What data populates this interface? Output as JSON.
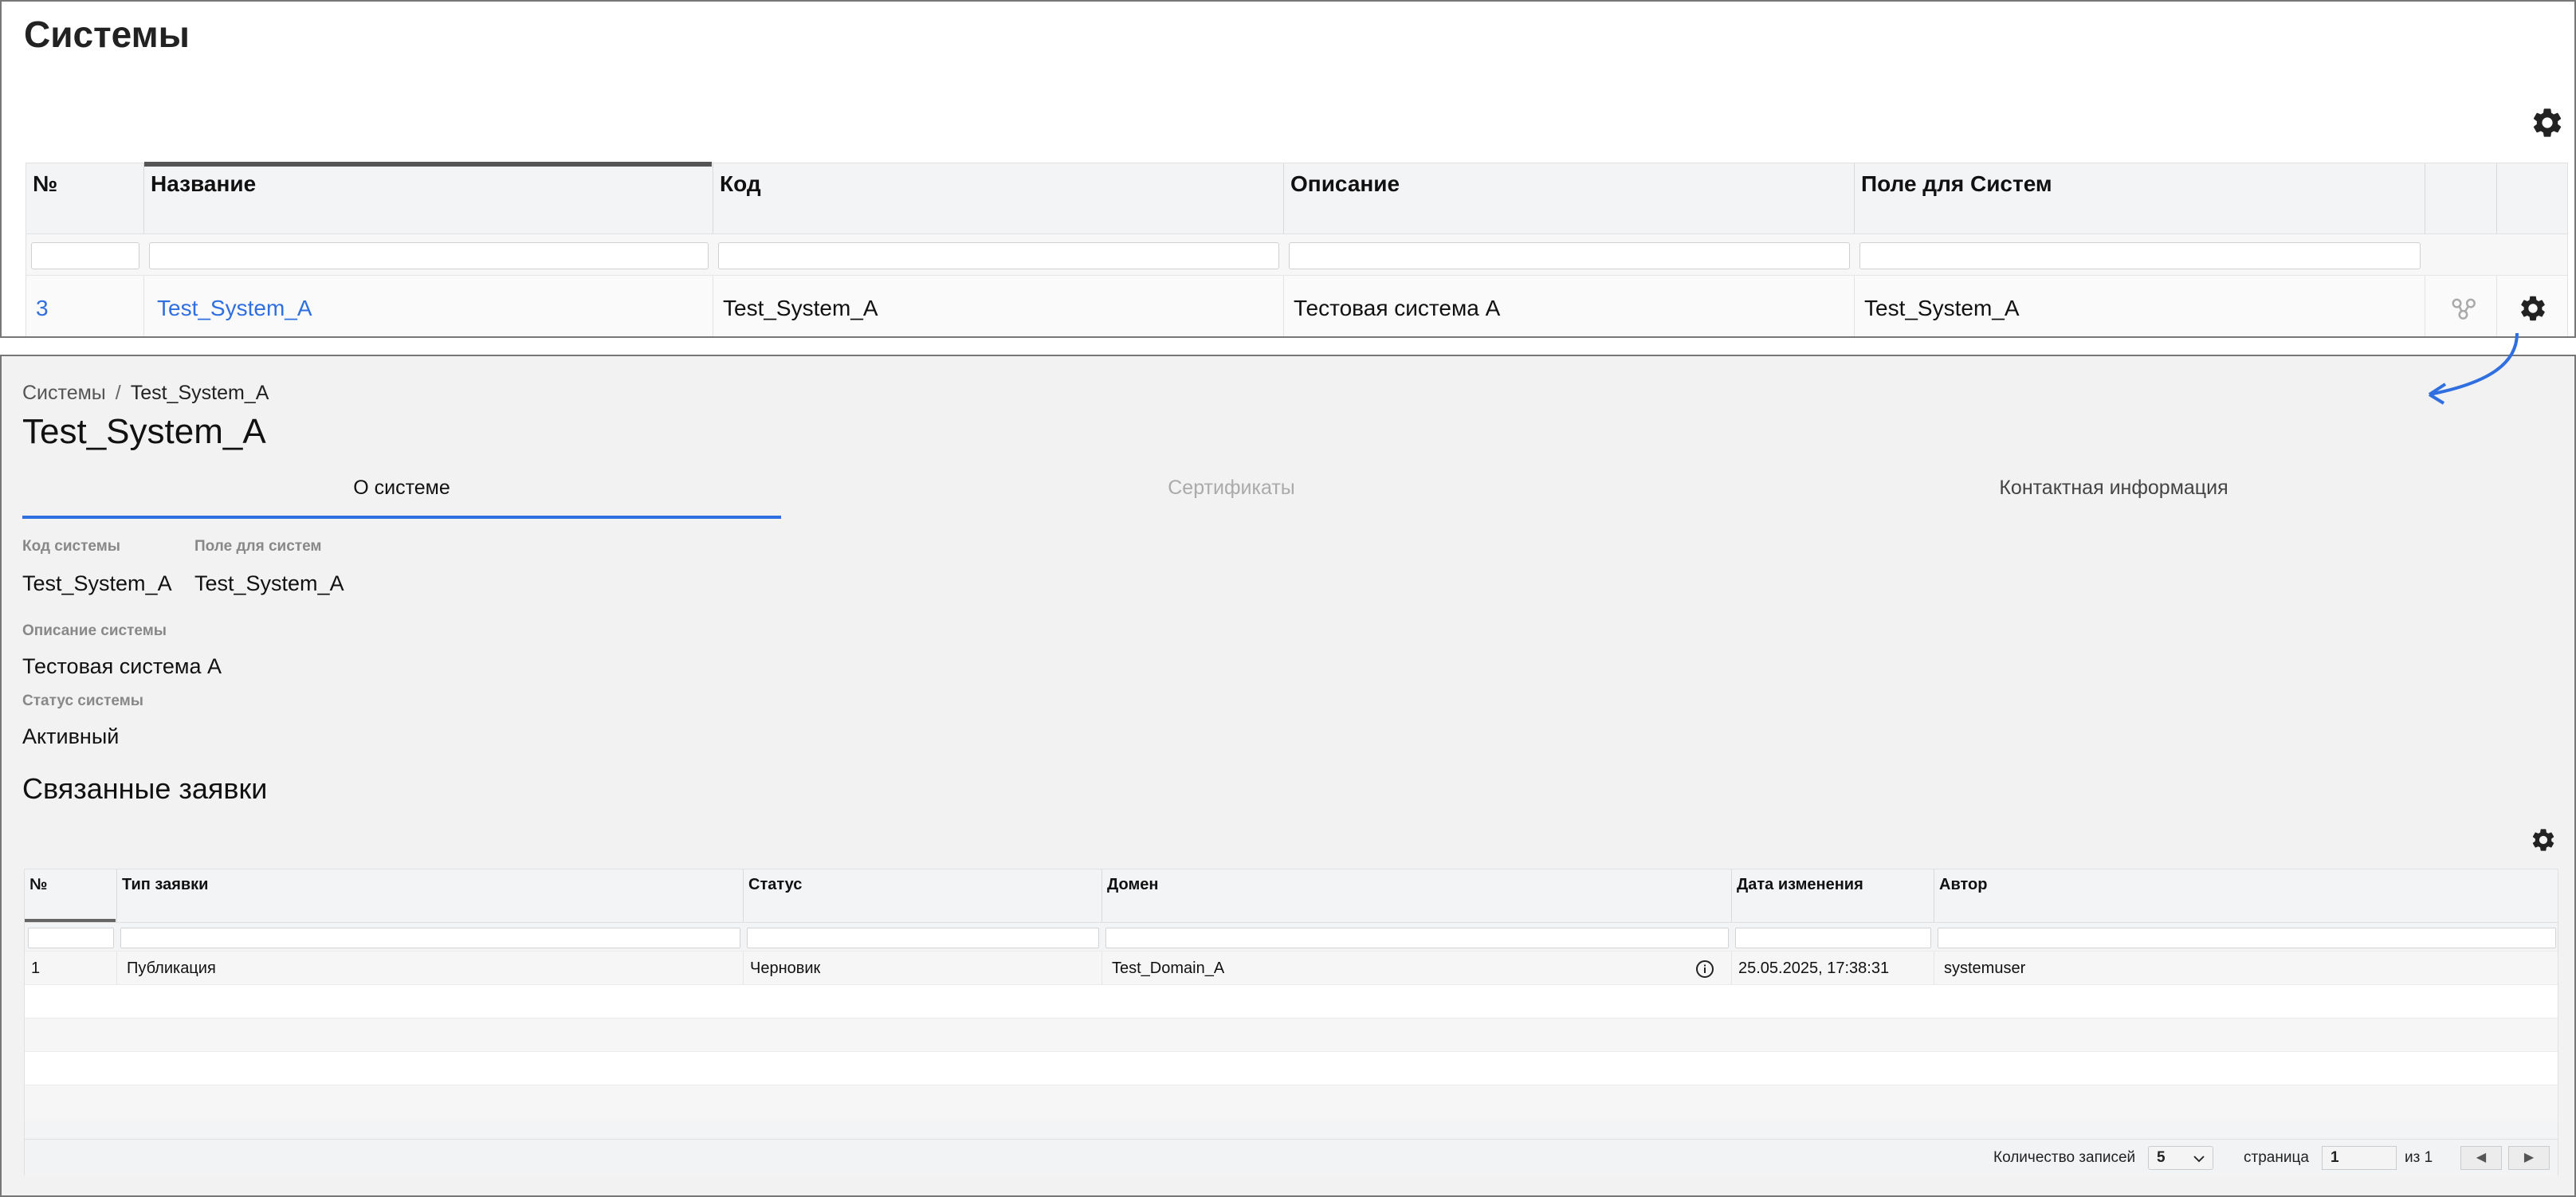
{
  "top": {
    "title": "Системы",
    "columns": [
      "№",
      "Название",
      "Код",
      "Описание",
      "Поле для Систем"
    ],
    "row": {
      "num": "3",
      "name": "Test_System_A",
      "code": "Test_System_A",
      "description": "Тестовая система А",
      "field": "Test_System_A"
    },
    "icons": {
      "settings": "gear-icon",
      "relations": "relations-icon"
    }
  },
  "detail": {
    "breadcrumb": {
      "root": "Системы",
      "separator": "/",
      "current": "Test_System_A"
    },
    "title": "Test_System_A",
    "tabs": [
      {
        "label": "О системе",
        "state": "active"
      },
      {
        "label": "Сертификаты",
        "state": "disabled"
      },
      {
        "label": "Контактная информация",
        "state": "normal"
      }
    ],
    "fields": {
      "code_label": "Код системы",
      "code_value": "Test_System_A",
      "field_label": "Поле для систем",
      "field_value": "Test_System_A",
      "desc_label": "Описание системы",
      "desc_value": "Тестовая система А",
      "status_label": "Статус системы",
      "status_value": "Активный"
    },
    "section_title": "Связанные заявки",
    "table": {
      "columns": [
        "№",
        "Тип заявки",
        "Статус",
        "Домен",
        "Дата изменения",
        "Автор"
      ],
      "rows": [
        {
          "num": "1",
          "type": "Публикация",
          "status": "Черновик",
          "domain": "Test_Domain_A",
          "date": "25.05.2025, 17:38:31",
          "author": "systemuser"
        }
      ]
    },
    "pager": {
      "records_label": "Количество записей",
      "records_value": "5",
      "page_label": "страница",
      "page_value": "1",
      "of_label": "из 1",
      "prev": "◀",
      "next": "▶"
    },
    "colors": {
      "accent": "#2f6fe0",
      "link": "#2f6fe0"
    }
  }
}
